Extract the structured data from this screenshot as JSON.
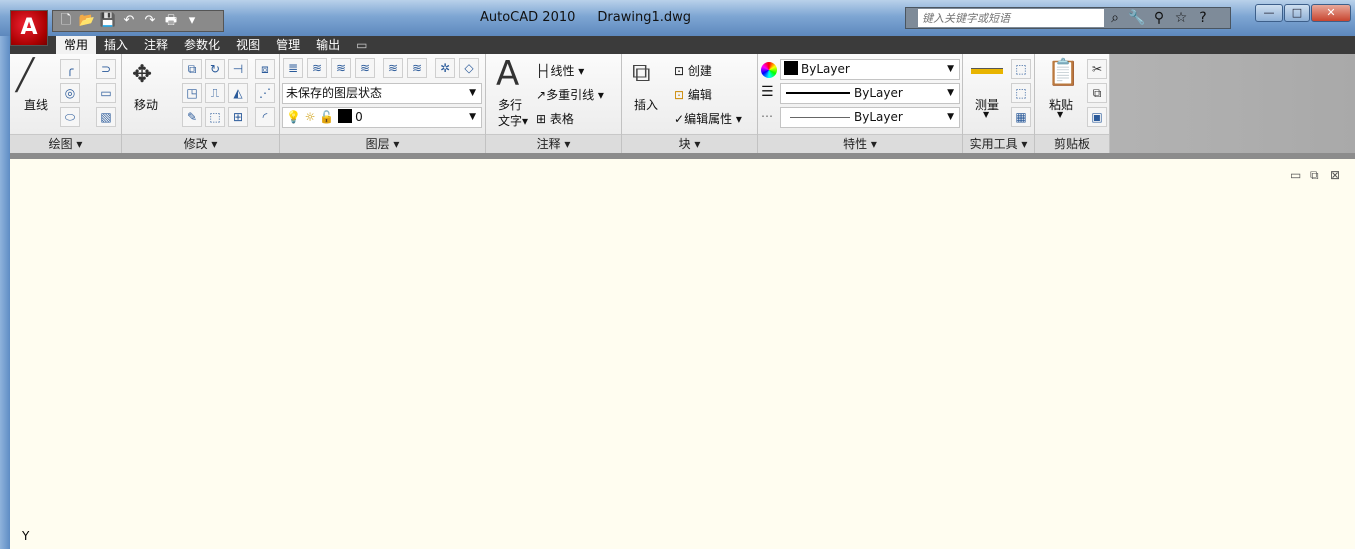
{
  "app": {
    "logo": "A",
    "title": "AutoCAD 2010",
    "document": "Drawing1.dwg"
  },
  "qat": [
    {
      "icon": "new-icon",
      "g": "🗋"
    },
    {
      "icon": "open-icon",
      "g": "📂"
    },
    {
      "icon": "save-icon",
      "g": "💾"
    },
    {
      "icon": "undo-icon",
      "g": "↶"
    },
    {
      "icon": "redo-icon",
      "g": "↷"
    },
    {
      "icon": "plot-icon",
      "g": "🖶"
    },
    {
      "icon": "customize-icon",
      "g": "▾"
    }
  ],
  "search": {
    "placeholder": "键入关键字或短语"
  },
  "tabs": [
    "常用",
    "插入",
    "注释",
    "参数化",
    "视图",
    "管理",
    "输出"
  ],
  "panels": {
    "draw": "绘图 ▾",
    "modify": "修改 ▾",
    "layers": "图层 ▾",
    "annotation": "注释 ▾",
    "block": "块 ▾",
    "properties": "特性 ▾",
    "utilities": "实用工具 ▾",
    "clipboard": "剪贴板"
  },
  "draw": {
    "line": "直线"
  },
  "modify": {
    "move": "移动"
  },
  "layers": {
    "state": "未保存的图层状态",
    "current": "0"
  },
  "annotation": {
    "mtext1": "多行",
    "mtext2": "文字▾",
    "linear": "线性 ▾",
    "mleader": "多重引线 ▾",
    "table": "表格"
  },
  "block": {
    "insert": "插入",
    "create": "创建",
    "edit": "编辑",
    "edit_attr": "编辑属性 ▾"
  },
  "properties": {
    "color": "ByLayer",
    "lineweight": "ByLayer",
    "linetype": "ByLayer"
  },
  "utilities": {
    "measure": "测量"
  },
  "clipboard": {
    "paste": "粘贴"
  },
  "canvas": {
    "ucs_y": "Y",
    "bg": "#fffdf0"
  }
}
